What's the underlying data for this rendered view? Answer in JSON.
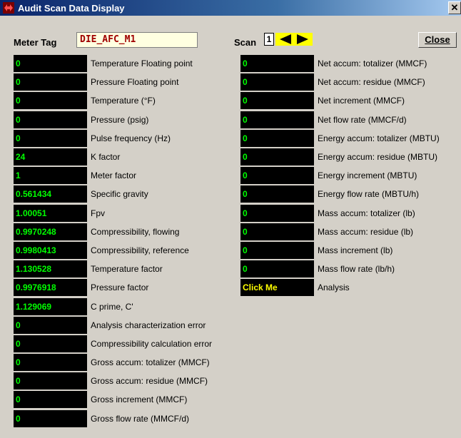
{
  "window": {
    "title": "Audit Scan Data Display",
    "close_glyph": "✕"
  },
  "header": {
    "meter_tag_label": "Meter Tag",
    "meter_tag_value": "DIE_AFC_M1",
    "scan_label": "Scan",
    "scan_value": "1",
    "close_button": "Close"
  },
  "left_rows": [
    {
      "value": "0",
      "label": "Temperature Floating point"
    },
    {
      "value": "0",
      "label": "Pressure Floating point"
    },
    {
      "value": "0",
      "label": "Temperature (°F)"
    },
    {
      "value": "0",
      "label": "Pressure (psig)"
    },
    {
      "value": "0",
      "label": "Pulse frequency (Hz)"
    },
    {
      "value": "24",
      "label": "K factor"
    },
    {
      "value": "1",
      "label": "Meter factor"
    },
    {
      "value": "0.561434",
      "label": "Specific gravity"
    },
    {
      "value": "1.00051",
      "label": "Fpv"
    },
    {
      "value": "0.9970248",
      "label": "Compressibility, flowing"
    },
    {
      "value": "0.9980413",
      "label": "Compressibility, reference"
    },
    {
      "value": "1.130528",
      "label": "Temperature factor"
    },
    {
      "value": "0.9976918",
      "label": "Pressure factor"
    },
    {
      "value": "1.129069",
      "label": "C prime, C'"
    },
    {
      "value": "0",
      "label": "Analysis characterization error"
    },
    {
      "value": "0",
      "label": "Compressibility calculation error"
    },
    {
      "value": "0",
      "label": "Gross accum: totalizer (MMCF)"
    },
    {
      "value": "0",
      "label": "Gross accum: residue (MMCF)"
    },
    {
      "value": "0",
      "label": "Gross increment (MMCF)"
    },
    {
      "value": "0",
      "label": "Gross flow rate (MMCF/d)"
    }
  ],
  "right_rows": [
    {
      "value": "0",
      "label": "Net accum: totalizer (MMCF)"
    },
    {
      "value": "0",
      "label": "Net accum: residue (MMCF)"
    },
    {
      "value": "0",
      "label": "Net increment (MMCF)"
    },
    {
      "value": "0",
      "label": "Net flow rate (MMCF/d)"
    },
    {
      "value": "0",
      "label": "Energy accum: totalizer (MBTU)"
    },
    {
      "value": "0",
      "label": "Energy accum: residue (MBTU)"
    },
    {
      "value": "0",
      "label": "Energy increment (MBTU)"
    },
    {
      "value": "0",
      "label": "Energy flow rate (MBTU/h)"
    },
    {
      "value": "0",
      "label": "Mass accum: totalizer (lb)"
    },
    {
      "value": "0",
      "label": "Mass accum: residue (lb)"
    },
    {
      "value": "0",
      "label": "Mass increment (lb)"
    },
    {
      "value": "0",
      "label": "Mass flow rate (lb/h)"
    },
    {
      "value": "Click Me",
      "label": "Analysis"
    }
  ],
  "colors": {
    "value_bg": "#000000",
    "value_text": "#00ff00",
    "clickme_text": "#ffff00",
    "meter_tag_text": "#a00000",
    "arrows_bg": "#ffff00"
  }
}
